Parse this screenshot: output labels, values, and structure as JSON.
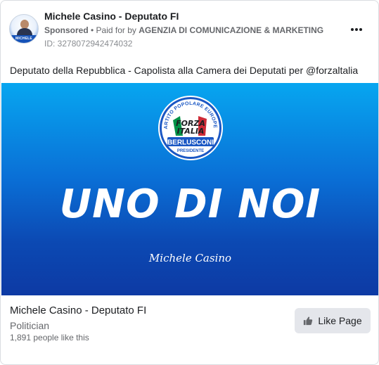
{
  "header": {
    "page_name": "Michele Casino - Deputato FI",
    "sponsored": "Sponsored",
    "separator": " • ",
    "paid_for_prefix": "Paid for by ",
    "payer": "AGENZIA DI COMUNICAZIONE & MARKETING",
    "ad_id": "ID: 3278072942474032",
    "avatar_band_text": "MICHELE CASINO",
    "more_icon": "more-horizontal-icon"
  },
  "post": {
    "caption": "Deputato della Repubblica - Capolista alla Camera dei Deputati per @forzaltalia"
  },
  "creative": {
    "logo_ring_text": "PARTITO POPOLARE EUROPEO",
    "logo_word1": "FORZA",
    "logo_word2": "ITALIA",
    "logo_word3": "BERLUSCONI",
    "logo_word4": "PRESIDENTE",
    "headline": "UNO DI NOI",
    "signature": "Michele Casino",
    "colors": {
      "gradient_top": "#07a6f0",
      "gradient_bottom": "#0d3aa4",
      "flag_green": "#009246",
      "flag_red": "#ce2b37"
    }
  },
  "footer": {
    "page_name": "Michele Casino - Deputato FI",
    "category": "Politician",
    "likes": "1,891 people like this",
    "like_button_label": "Like Page",
    "like_icon": "thumbs-up-icon"
  }
}
